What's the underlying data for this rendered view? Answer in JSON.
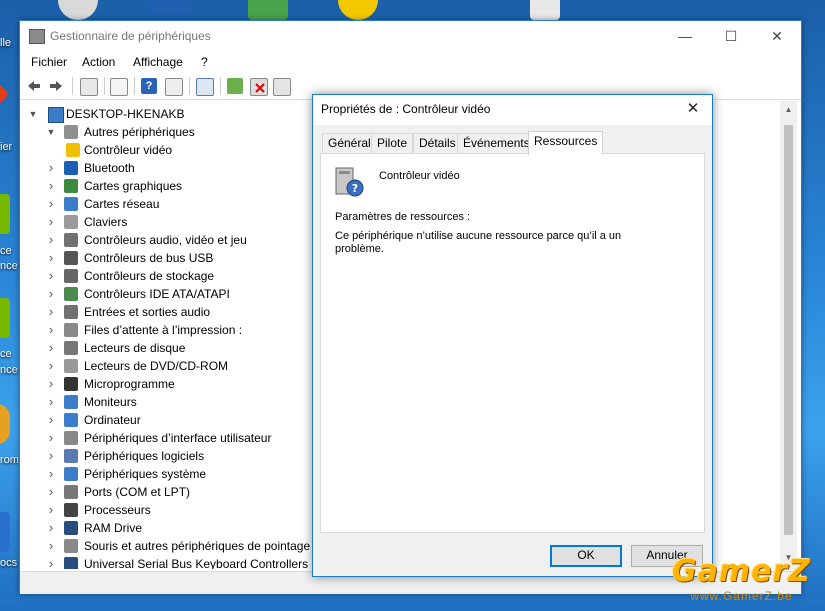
{
  "desktop": {
    "labels": [
      "lle",
      "ier",
      "ce",
      "nce",
      "ce",
      "nce",
      "rom",
      "ocs"
    ]
  },
  "window": {
    "title": "Gestionnaire de périphériques",
    "minimize": "—",
    "maximize": "☐",
    "close": "✕"
  },
  "menu": [
    "Fichier",
    "Action",
    "Affichage",
    "?"
  ],
  "tree": {
    "root": "DESKTOP-HKENAKB",
    "items": [
      {
        "label": "Autres périphériques",
        "expanded": true,
        "icon": "other-devices-icon"
      },
      {
        "label": "Contrôleur vidéo",
        "child": true,
        "icon": "unknown-device-warning-icon"
      },
      {
        "label": "Bluetooth",
        "icon": "bluetooth-icon"
      },
      {
        "label": "Cartes graphiques",
        "icon": "display-adapter-icon"
      },
      {
        "label": "Cartes réseau",
        "icon": "network-adapter-icon"
      },
      {
        "label": "Claviers",
        "icon": "keyboard-icon"
      },
      {
        "label": "Contrôleurs audio, vidéo et jeu",
        "icon": "audio-icon"
      },
      {
        "label": "Contrôleurs de bus USB",
        "icon": "usb-icon"
      },
      {
        "label": "Contrôleurs de stockage",
        "icon": "storage-controller-icon"
      },
      {
        "label": "Contrôleurs IDE ATA/ATAPI",
        "icon": "ide-icon"
      },
      {
        "label": "Entrées et sorties audio",
        "icon": "speaker-icon"
      },
      {
        "label": "Files d’attente à l’impression :",
        "icon": "printer-icon"
      },
      {
        "label": "Lecteurs de disque",
        "icon": "disk-drive-icon"
      },
      {
        "label": "Lecteurs de DVD/CD-ROM",
        "icon": "dvd-icon"
      },
      {
        "label": "Microprogramme",
        "icon": "firmware-icon"
      },
      {
        "label": "Moniteurs",
        "icon": "monitor-icon"
      },
      {
        "label": "Ordinateur",
        "icon": "computer-icon"
      },
      {
        "label": "Périphériques d’interface utilisateur",
        "icon": "hid-icon"
      },
      {
        "label": "Périphériques logiciels",
        "icon": "software-device-icon"
      },
      {
        "label": "Périphériques système",
        "icon": "system-device-icon"
      },
      {
        "label": "Ports (COM et LPT)",
        "icon": "port-icon"
      },
      {
        "label": "Processeurs",
        "icon": "processor-icon"
      },
      {
        "label": "RAM Drive",
        "icon": "ram-icon"
      },
      {
        "label": "Souris et autres périphériques de pointage",
        "icon": "mouse-icon"
      },
      {
        "label": "Universal Serial Bus Keyboard Controllers",
        "icon": "usb-keyboard-icon"
      }
    ]
  },
  "dialog": {
    "title": "Propriétés de : Contrôleur vidéo",
    "close": "✕",
    "tabs": [
      "Général",
      "Pilote",
      "Détails",
      "Événements",
      "Ressources"
    ],
    "active_tab": "Ressources",
    "device_name": "Contrôleur vidéo",
    "section_label": "Paramètres de ressources :",
    "message": "Ce périphérique n’utilise aucune ressource parce qu’il a un problème.",
    "ok": "OK",
    "cancel": "Annuler"
  },
  "watermark": {
    "logo": "GamerZ",
    "url": "www.GamerZ.be"
  },
  "colors": {
    "accent": "#0078d7",
    "window_border": "#2b7ad0",
    "desktop": "#2a86d8",
    "watermark": "#ffb400"
  }
}
